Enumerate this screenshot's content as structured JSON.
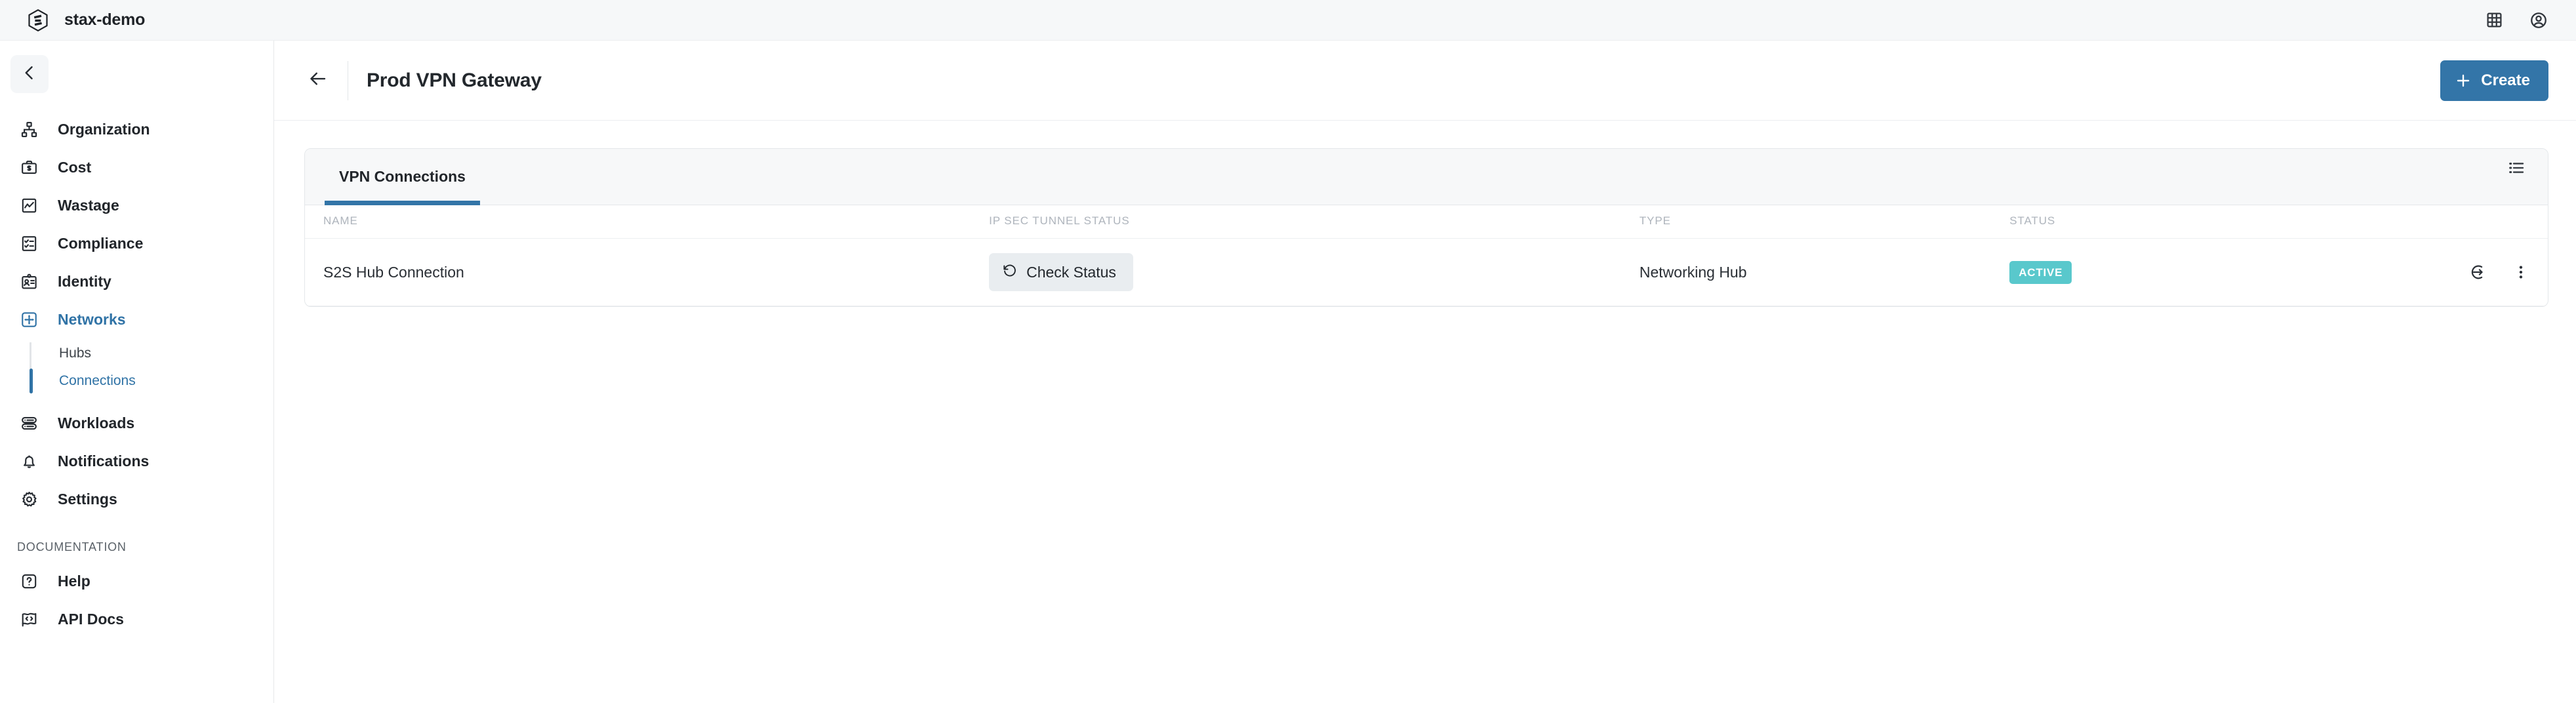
{
  "topbar": {
    "logo_icon": "stax-hexagon-logo-icon",
    "brand": "stax-demo",
    "icons": [
      {
        "name": "apps-grid-icon",
        "label": "Apps"
      },
      {
        "name": "account-circle-icon",
        "label": "Account"
      }
    ]
  },
  "sidebar": {
    "collapse_icon": "chevron-left-icon",
    "items": [
      {
        "label": "Organization",
        "icon": "org-chart-icon",
        "active": false
      },
      {
        "label": "Cost",
        "icon": "briefcase-dollar-icon",
        "active": false
      },
      {
        "label": "Wastage",
        "icon": "chart-trend-icon",
        "active": false
      },
      {
        "label": "Compliance",
        "icon": "checklist-icon",
        "active": false
      },
      {
        "label": "Identity",
        "icon": "id-badge-icon",
        "active": false
      },
      {
        "label": "Networks",
        "icon": "network-move-icon",
        "active": true
      },
      {
        "label": "Workloads",
        "icon": "server-stack-icon",
        "active": false
      },
      {
        "label": "Notifications",
        "icon": "bell-icon",
        "active": false
      },
      {
        "label": "Settings",
        "icon": "gear-icon",
        "active": false
      }
    ],
    "networks_subitems": [
      {
        "label": "Hubs",
        "active": false
      },
      {
        "label": "Connections",
        "active": true
      }
    ],
    "section_title": "Documentation",
    "doc_items": [
      {
        "label": "Help",
        "icon": "question-square-icon"
      },
      {
        "label": "API Docs",
        "icon": "code-flag-icon"
      }
    ]
  },
  "header": {
    "back_icon": "arrow-left-icon",
    "title": "Prod VPN Gateway",
    "create_label": "Create",
    "create_icon": "plus-icon",
    "accent_color": "#3375a8"
  },
  "card": {
    "tabs": [
      {
        "label": "VPN Connections",
        "active": true
      }
    ],
    "list_view_icon": "list-view-icon",
    "columns": [
      "Name",
      "IP Sec Tunnel Status",
      "Type",
      "Status",
      ""
    ],
    "rows": [
      {
        "name": "S2S Hub Connection",
        "tunnel_action": "Check Status",
        "tunnel_action_icon": "refresh-ccw-icon",
        "type": "Networking Hub",
        "status": "Active",
        "status_color": "#59c8cc",
        "actions": [
          {
            "name": "enter-circle-icon"
          },
          {
            "name": "more-vertical-icon"
          }
        ]
      }
    ]
  }
}
